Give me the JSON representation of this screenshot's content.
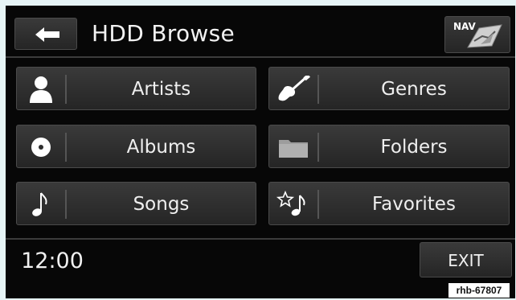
{
  "header": {
    "title": "HDD Browse",
    "back_icon": "back-arrow-icon",
    "nav_label": "NAV",
    "nav_icon": "nav-map-icon"
  },
  "menu": [
    {
      "label": "Artists",
      "icon": "person-icon"
    },
    {
      "label": "Genres",
      "icon": "guitar-icon"
    },
    {
      "label": "Albums",
      "icon": "disc-icon"
    },
    {
      "label": "Folders",
      "icon": "folder-icon"
    },
    {
      "label": "Songs",
      "icon": "music-note-icon"
    },
    {
      "label": "Favorites",
      "icon": "star-note-icon"
    }
  ],
  "footer": {
    "clock": "12:00",
    "exit_label": "EXIT"
  },
  "image_code": "rhb-67807",
  "colors": {
    "background": "#070707",
    "button": "#2e2e2e",
    "text": "#efefef"
  }
}
